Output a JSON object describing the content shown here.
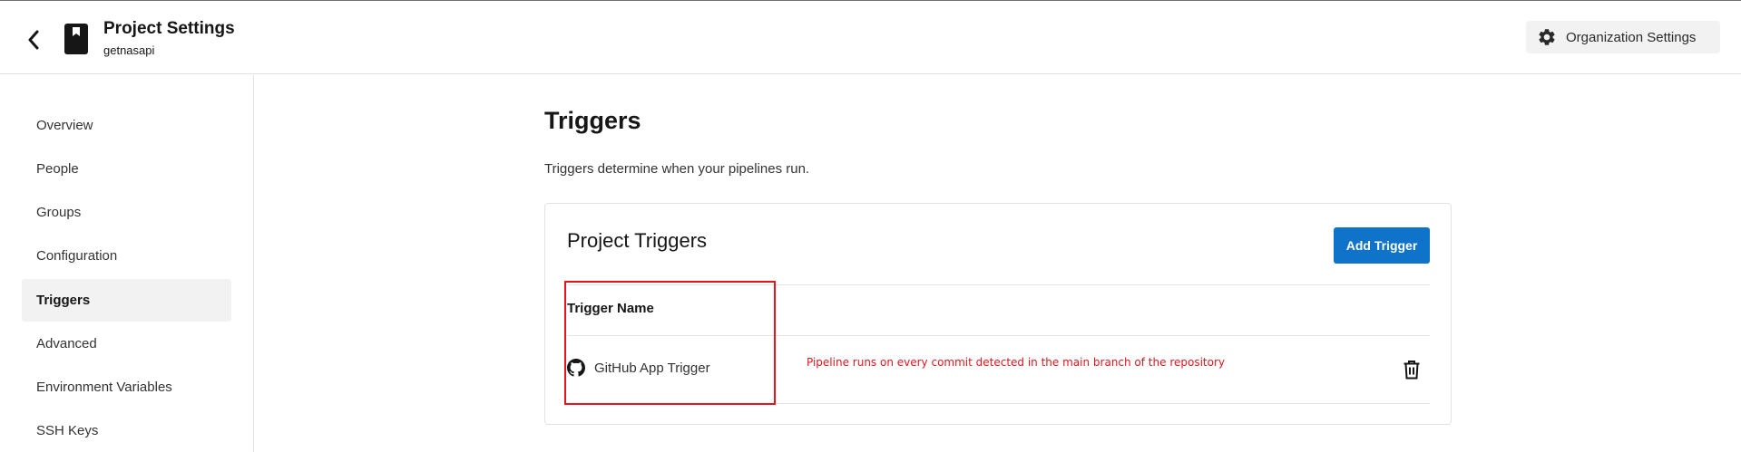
{
  "header": {
    "title": "Project Settings",
    "subtitle": "getnasapi",
    "org_settings_label": "Organization Settings"
  },
  "sidebar": {
    "items": [
      {
        "label": "Overview"
      },
      {
        "label": "People"
      },
      {
        "label": "Groups"
      },
      {
        "label": "Configuration"
      },
      {
        "label": "Triggers",
        "active": true
      },
      {
        "label": "Advanced"
      },
      {
        "label": "Environment Variables"
      },
      {
        "label": "SSH Keys"
      }
    ]
  },
  "main": {
    "title": "Triggers",
    "description": "Triggers determine when your pipelines run.",
    "card": {
      "title": "Project Triggers",
      "add_button_label": "Add Trigger",
      "column_header": "Trigger Name",
      "rows": [
        {
          "name": "GitHub App Trigger",
          "icon": "github-icon"
        }
      ]
    }
  },
  "annotation": {
    "text": "Pipeline runs on every commit detected in the main branch of the repository",
    "color": "#e8141c"
  },
  "colors": {
    "accent": "#0f74c9",
    "highlight": "#e8141c"
  }
}
